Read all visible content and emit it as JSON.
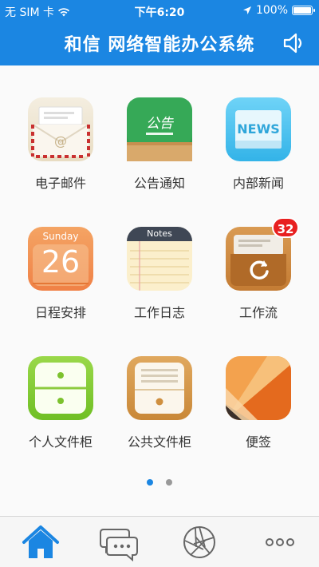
{
  "status_bar": {
    "carrier": "无 SIM 卡",
    "time": "下午6:20",
    "battery": "100%",
    "battery_level": 1.0
  },
  "header": {
    "title": "和信 网络智能办公系统",
    "speaker_icon": "speaker-icon"
  },
  "apps": [
    {
      "label": "电子邮件",
      "icon": "mail-icon"
    },
    {
      "label": "公告通知",
      "icon": "notice-board-icon",
      "icon_text": "公告"
    },
    {
      "label": "内部新闻",
      "icon": "news-icon",
      "icon_text": "NEWS"
    },
    {
      "label": "日程安排",
      "icon": "calendar-icon",
      "icon_text": "Sunday",
      "icon_number": "26"
    },
    {
      "label": "工作日志",
      "icon": "notes-icon",
      "icon_text": "Notes"
    },
    {
      "label": "工作流",
      "icon": "workflow-icon",
      "badge": "32"
    },
    {
      "label": "个人文件柜",
      "icon": "personal-cabinet-icon"
    },
    {
      "label": "公共文件柜",
      "icon": "public-cabinet-icon"
    },
    {
      "label": "便签",
      "icon": "memo-icon"
    }
  ],
  "pager": {
    "pages": 2,
    "current": 1
  },
  "tabbar": {
    "tabs": [
      {
        "icon": "home-icon",
        "active": true
      },
      {
        "icon": "chat-icon",
        "active": false
      },
      {
        "icon": "aperture-icon",
        "active": false
      },
      {
        "icon": "more-icon",
        "active": false
      }
    ]
  },
  "colors": {
    "primary": "#1b86e2",
    "badge": "#e82020"
  }
}
